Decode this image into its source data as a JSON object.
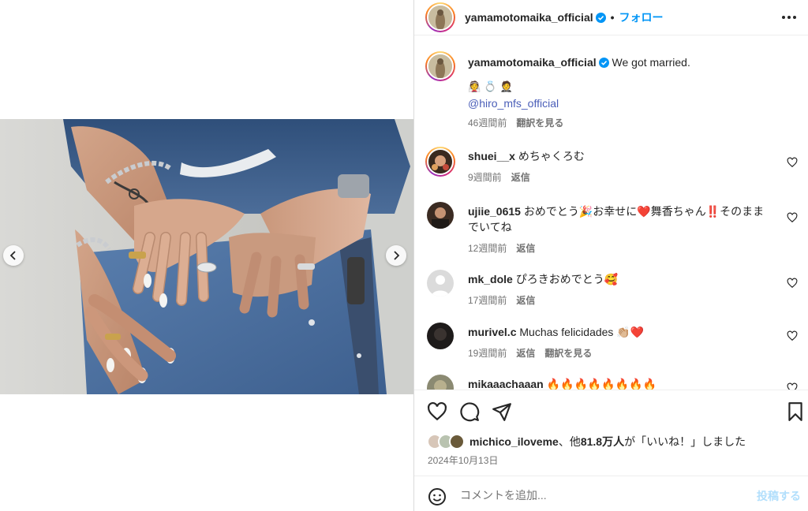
{
  "post": {
    "username": "yamamotomaika_official",
    "follow_label": "フォロー",
    "separator": "•"
  },
  "caption": {
    "username": "yamamotomaika_official",
    "text": "We got married.",
    "emojis": "👰 💍 🤵",
    "mention": "@hiro_mfs_official",
    "time": "46週間前",
    "translate": "翻訳を見る"
  },
  "comments": [
    {
      "username": "shuei__x",
      "text": "めちゃくろむ",
      "time": "9週間前",
      "reply": "返信",
      "translate": ""
    },
    {
      "username": "ujiie_0615",
      "text": "おめでとう🎉お幸せに❤️舞香ちゃん‼️そのままでいてね",
      "time": "12週間前",
      "reply": "返信",
      "translate": ""
    },
    {
      "username": "mk_dole",
      "text": "ぴろきおめでとう🥰",
      "time": "17週間前",
      "reply": "返信",
      "translate": ""
    },
    {
      "username": "murivel.c",
      "text": "Muchas felicidades 👏🏼❤️",
      "time": "19週間前",
      "reply": "返信",
      "translate": "翻訳を見る"
    },
    {
      "username": "mikaaachaaan",
      "text": "🔥🔥🔥🔥🔥🔥🔥🔥",
      "time": "",
      "reply": "",
      "translate": ""
    }
  ],
  "likes": {
    "user": "michico_iloveme",
    "middle": "、他",
    "count": "81.8万人",
    "suffix": "が「いいね！」しました"
  },
  "date": "2024年10月13日",
  "comment_box": {
    "placeholder": "コメントを追加...",
    "post_label": "投稿する"
  },
  "icons": {
    "like": "heart-icon",
    "comment": "comment-icon",
    "share": "share-icon",
    "save": "bookmark-icon",
    "emoji": "emoji-icon",
    "more": "more-icon",
    "prev": "chevron-left-icon",
    "next": "chevron-right-icon"
  },
  "colors": {
    "accent": "#0095f6",
    "mention": "#4a5eb8",
    "secondary_text": "#737373",
    "post_disabled": "#b2dffc"
  }
}
